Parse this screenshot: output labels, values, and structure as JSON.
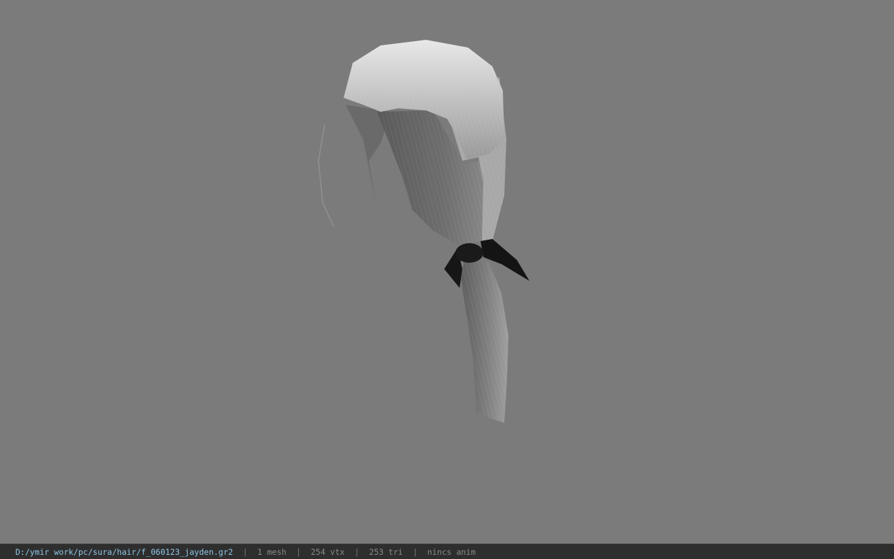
{
  "viewport": {
    "background": "#7b7b7b",
    "model": "hair-mesh",
    "hair_color": "#8a8a8a",
    "tie_color": "#141414"
  },
  "statusbar": {
    "file_path": "D:/ymir work/pc/sura/hair/f_060123_jayden.gr2",
    "separator": "|",
    "mesh_count": "1 mesh",
    "vertex_count": "254 vtx",
    "triangle_count": "253 tri",
    "anim_status": "nincs anim",
    "path_color": "#8fc6e6"
  }
}
